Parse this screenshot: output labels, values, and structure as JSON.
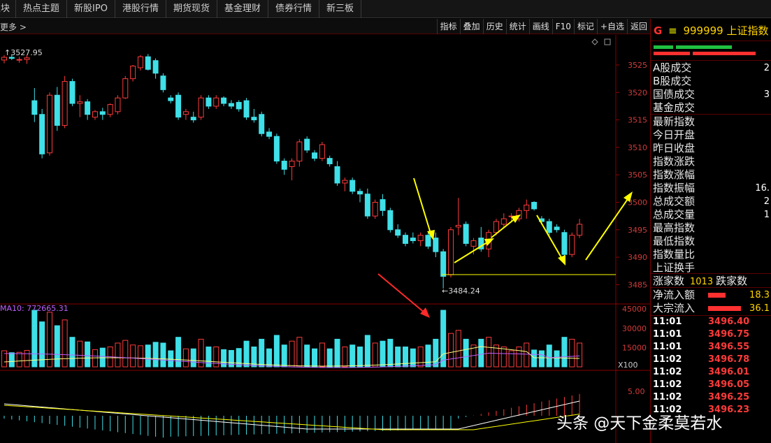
{
  "nav": {
    "items": [
      "板块",
      "热点主题",
      "新股IPO",
      "港股行情",
      "期货现货",
      "基金理财",
      "债券行情",
      "新三板"
    ]
  },
  "toolbar": {
    "breadcrumb": "更多 >",
    "tools": [
      "指标",
      "叠加",
      "历史",
      "统计",
      "画线",
      "F10",
      "标记",
      "+自选",
      "返回"
    ]
  },
  "chart": {
    "max_label": "3527.95",
    "min_label": "3484.24",
    "price_ticks": [
      "3525",
      "3520",
      "3515",
      "3510",
      "3505",
      "3500",
      "3495",
      "3490",
      "3485"
    ],
    "vol_ticks": [
      "45000",
      "30000",
      "15000"
    ],
    "vol_unit": "X100",
    "macd_tick": "5.00",
    "vol_ma_label": "MA10: 772665.31",
    "colors": {
      "up": "#ff3b3b",
      "down": "#3fe0e8",
      "arrow_yellow": "#ffff00",
      "arrow_red": "#ff3030"
    }
  },
  "chart_data": {
    "type": "candlestick",
    "interval": "1-minute",
    "title": "",
    "ylim": [
      3483,
      3530
    ],
    "candles": [
      {
        "o": 3525.9,
        "h": 3526.8,
        "l": 3525.3,
        "c": 3526.4
      },
      {
        "o": 3526.4,
        "h": 3526.9,
        "l": 3525.9,
        "c": 3526.2
      },
      {
        "o": 3525.9,
        "h": 3526.5,
        "l": 3525.4,
        "c": 3526.0
      },
      {
        "o": 3526.0,
        "h": 3526.8,
        "l": 3525.2,
        "c": 3526.3
      },
      {
        "o": 3518.5,
        "h": 3520.8,
        "l": 3514.6,
        "c": 3516.0
      },
      {
        "o": 3516.0,
        "h": 3517.0,
        "l": 3508.0,
        "c": 3508.8
      },
      {
        "o": 3509.0,
        "h": 3520.0,
        "l": 3508.5,
        "c": 3519.5
      },
      {
        "o": 3519.5,
        "h": 3521.0,
        "l": 3513.0,
        "c": 3514.0
      },
      {
        "o": 3514.0,
        "h": 3523.0,
        "l": 3513.5,
        "c": 3522.0
      },
      {
        "o": 3522.0,
        "h": 3522.5,
        "l": 3517.5,
        "c": 3518.0
      },
      {
        "o": 3518.0,
        "h": 3519.5,
        "l": 3515.5,
        "c": 3518.3
      },
      {
        "o": 3518.3,
        "h": 3518.8,
        "l": 3515.0,
        "c": 3516.0
      },
      {
        "o": 3515.5,
        "h": 3516.8,
        "l": 3515.0,
        "c": 3516.5
      },
      {
        "o": 3516.5,
        "h": 3517.2,
        "l": 3515.0,
        "c": 3516.0
      },
      {
        "o": 3516.0,
        "h": 3518.0,
        "l": 3515.5,
        "c": 3517.8
      },
      {
        "o": 3516.5,
        "h": 3519.5,
        "l": 3516.0,
        "c": 3519.0
      },
      {
        "o": 3519.0,
        "h": 3523.0,
        "l": 3518.8,
        "c": 3522.5
      },
      {
        "o": 3522.5,
        "h": 3525.0,
        "l": 3522.0,
        "c": 3524.8
      },
      {
        "o": 3524.5,
        "h": 3526.8,
        "l": 3524.0,
        "c": 3526.5
      },
      {
        "o": 3526.5,
        "h": 3527.0,
        "l": 3524.0,
        "c": 3524.2
      },
      {
        "o": 3525.8,
        "h": 3526.2,
        "l": 3522.5,
        "c": 3523.5
      },
      {
        "o": 3523.0,
        "h": 3523.5,
        "l": 3520.0,
        "c": 3520.5
      },
      {
        "o": 3519.0,
        "h": 3519.5,
        "l": 3518.0,
        "c": 3518.5
      },
      {
        "o": 3519.5,
        "h": 3520.0,
        "l": 3515.0,
        "c": 3515.5
      },
      {
        "o": 3516.0,
        "h": 3517.0,
        "l": 3515.0,
        "c": 3516.5
      },
      {
        "o": 3515.5,
        "h": 3516.5,
        "l": 3514.5,
        "c": 3515.0
      },
      {
        "o": 3515.5,
        "h": 3519.5,
        "l": 3515.0,
        "c": 3519.0
      },
      {
        "o": 3519.0,
        "h": 3519.5,
        "l": 3517.0,
        "c": 3517.5
      },
      {
        "o": 3517.5,
        "h": 3519.5,
        "l": 3517.0,
        "c": 3519.0
      },
      {
        "o": 3519.0,
        "h": 3519.3,
        "l": 3517.5,
        "c": 3518.0
      },
      {
        "o": 3518.0,
        "h": 3518.6,
        "l": 3517.0,
        "c": 3517.5
      },
      {
        "o": 3518.2,
        "h": 3518.6,
        "l": 3516.5,
        "c": 3517.0
      },
      {
        "o": 3518.5,
        "h": 3519.0,
        "l": 3515.0,
        "c": 3515.5
      },
      {
        "o": 3515.5,
        "h": 3517.0,
        "l": 3514.5,
        "c": 3515.0
      },
      {
        "o": 3516.0,
        "h": 3516.5,
        "l": 3512.0,
        "c": 3512.5
      },
      {
        "o": 3512.8,
        "h": 3513.5,
        "l": 3511.5,
        "c": 3512.0
      },
      {
        "o": 3512.0,
        "h": 3512.5,
        "l": 3507.0,
        "c": 3507.5
      },
      {
        "o": 3507.5,
        "h": 3508.0,
        "l": 3505.0,
        "c": 3506.0
      },
      {
        "o": 3506.5,
        "h": 3508.0,
        "l": 3504.0,
        "c": 3507.5
      },
      {
        "o": 3507.5,
        "h": 3511.5,
        "l": 3506.5,
        "c": 3511.0
      },
      {
        "o": 3511.5,
        "h": 3512.0,
        "l": 3509.0,
        "c": 3509.5
      },
      {
        "o": 3509.0,
        "h": 3509.5,
        "l": 3507.5,
        "c": 3508.0
      },
      {
        "o": 3508.0,
        "h": 3511.0,
        "l": 3507.5,
        "c": 3510.5
      },
      {
        "o": 3508.0,
        "h": 3508.5,
        "l": 3506.5,
        "c": 3507.0
      },
      {
        "o": 3506.5,
        "h": 3507.5,
        "l": 3503.0,
        "c": 3503.5
      },
      {
        "o": 3503.5,
        "h": 3504.5,
        "l": 3502.0,
        "c": 3504.0
      },
      {
        "o": 3504.0,
        "h": 3504.5,
        "l": 3501.5,
        "c": 3502.0
      },
      {
        "o": 3502.0,
        "h": 3502.5,
        "l": 3500.0,
        "c": 3501.5
      },
      {
        "o": 3501.5,
        "h": 3502.5,
        "l": 3497.0,
        "c": 3497.5
      },
      {
        "o": 3497.5,
        "h": 3500.5,
        "l": 3497.0,
        "c": 3500.0
      },
      {
        "o": 3500.5,
        "h": 3501.5,
        "l": 3497.5,
        "c": 3498.5
      },
      {
        "o": 3498.5,
        "h": 3499.0,
        "l": 3494.5,
        "c": 3495.0
      },
      {
        "o": 3495.0,
        "h": 3496.0,
        "l": 3493.5,
        "c": 3494.0
      },
      {
        "o": 3494.0,
        "h": 3494.5,
        "l": 3492.0,
        "c": 3492.5
      },
      {
        "o": 3493.5,
        "h": 3494.5,
        "l": 3492.5,
        "c": 3493.0
      },
      {
        "o": 3493.0,
        "h": 3494.5,
        "l": 3492.0,
        "c": 3494.0
      },
      {
        "o": 3494.0,
        "h": 3494.5,
        "l": 3491.5,
        "c": 3492.0
      },
      {
        "o": 3493.5,
        "h": 3494.5,
        "l": 3490.0,
        "c": 3491.0
      },
      {
        "o": 3491.0,
        "h": 3491.5,
        "l": 3484.3,
        "c": 3486.5
      },
      {
        "o": 3486.8,
        "h": 3495.5,
        "l": 3486.3,
        "c": 3495.0
      },
      {
        "o": 3495.5,
        "h": 3500.8,
        "l": 3494.0,
        "c": 3495.8
      },
      {
        "o": 3496.0,
        "h": 3496.5,
        "l": 3492.0,
        "c": 3492.5
      },
      {
        "o": 3492.0,
        "h": 3493.5,
        "l": 3490.5,
        "c": 3493.0
      },
      {
        "o": 3493.5,
        "h": 3495.5,
        "l": 3491.0,
        "c": 3491.5
      },
      {
        "o": 3491.5,
        "h": 3495.0,
        "l": 3490.0,
        "c": 3494.5
      },
      {
        "o": 3494.5,
        "h": 3497.0,
        "l": 3494.0,
        "c": 3496.5
      },
      {
        "o": 3496.0,
        "h": 3498.0,
        "l": 3495.5,
        "c": 3497.0
      },
      {
        "o": 3497.5,
        "h": 3498.0,
        "l": 3496.5,
        "c": 3497.5
      },
      {
        "o": 3497.0,
        "h": 3499.0,
        "l": 3496.5,
        "c": 3498.5
      },
      {
        "o": 3498.5,
        "h": 3500.5,
        "l": 3497.0,
        "c": 3499.5
      },
      {
        "o": 3500.0,
        "h": 3500.2,
        "l": 3498.5,
        "c": 3498.8
      },
      {
        "o": 3497.0,
        "h": 3497.5,
        "l": 3496.0,
        "c": 3496.5
      },
      {
        "o": 3496.5,
        "h": 3497.0,
        "l": 3494.0,
        "c": 3494.5
      },
      {
        "o": 3495.5,
        "h": 3496.0,
        "l": 3494.5,
        "c": 3495.0
      },
      {
        "o": 3494.5,
        "h": 3495.0,
        "l": 3490.0,
        "c": 3490.5
      },
      {
        "o": 3490.5,
        "h": 3494.5,
        "l": 3490.0,
        "c": 3494.0
      },
      {
        "o": 3494.0,
        "h": 3497.0,
        "l": 3493.5,
        "c": 3496.0
      }
    ],
    "volume_ma_label": "MA10: 772665.31",
    "annotations": [
      "3527.95",
      "3484.24"
    ]
  },
  "panel": {
    "flag": "G",
    "eq": "≡",
    "code": "999999",
    "name": "上证指数",
    "group_a": [
      {
        "label": "A股成交",
        "value": "2"
      },
      {
        "label": "B股成交",
        "value": ""
      },
      {
        "label": "国债成交",
        "value": "3"
      },
      {
        "label": "基金成交",
        "value": ""
      }
    ],
    "group_b": [
      {
        "label": "最新指数",
        "value": ""
      },
      {
        "label": "今日开盘",
        "value": ""
      },
      {
        "label": "昨日收盘",
        "value": ""
      },
      {
        "label": "指数涨跌",
        "value": ""
      },
      {
        "label": "指数涨幅",
        "value": ""
      },
      {
        "label": "指数振幅",
        "value": "16."
      },
      {
        "label": "总成交额",
        "value": "2"
      },
      {
        "label": "总成交量",
        "value": "1"
      },
      {
        "label": "最高指数",
        "value": ""
      },
      {
        "label": "最低指数",
        "value": ""
      },
      {
        "label": "指数量比",
        "value": ""
      },
      {
        "label": "上证换手",
        "value": ""
      }
    ],
    "up_label": "涨家数",
    "up_count": "1013",
    "down_label": "跌家数",
    "flows": [
      {
        "label": "净流入额",
        "value": "18.3",
        "bar": 0.42
      },
      {
        "label": "大宗流入",
        "value": "36.1",
        "bar": 0.78
      }
    ],
    "trades": [
      {
        "time": "11:01",
        "price": "3496.40"
      },
      {
        "time": "11:01",
        "price": "3496.75"
      },
      {
        "time": "11:01",
        "price": "3496.55"
      },
      {
        "time": "11:02",
        "price": "3496.78"
      },
      {
        "time": "11:02",
        "price": "3496.01"
      },
      {
        "time": "11:02",
        "price": "3496.05"
      },
      {
        "time": "11:02",
        "price": "3496.25"
      },
      {
        "time": "11:02",
        "price": "3496.23"
      }
    ]
  },
  "watermark": "头条 @天下金柔莫若水"
}
